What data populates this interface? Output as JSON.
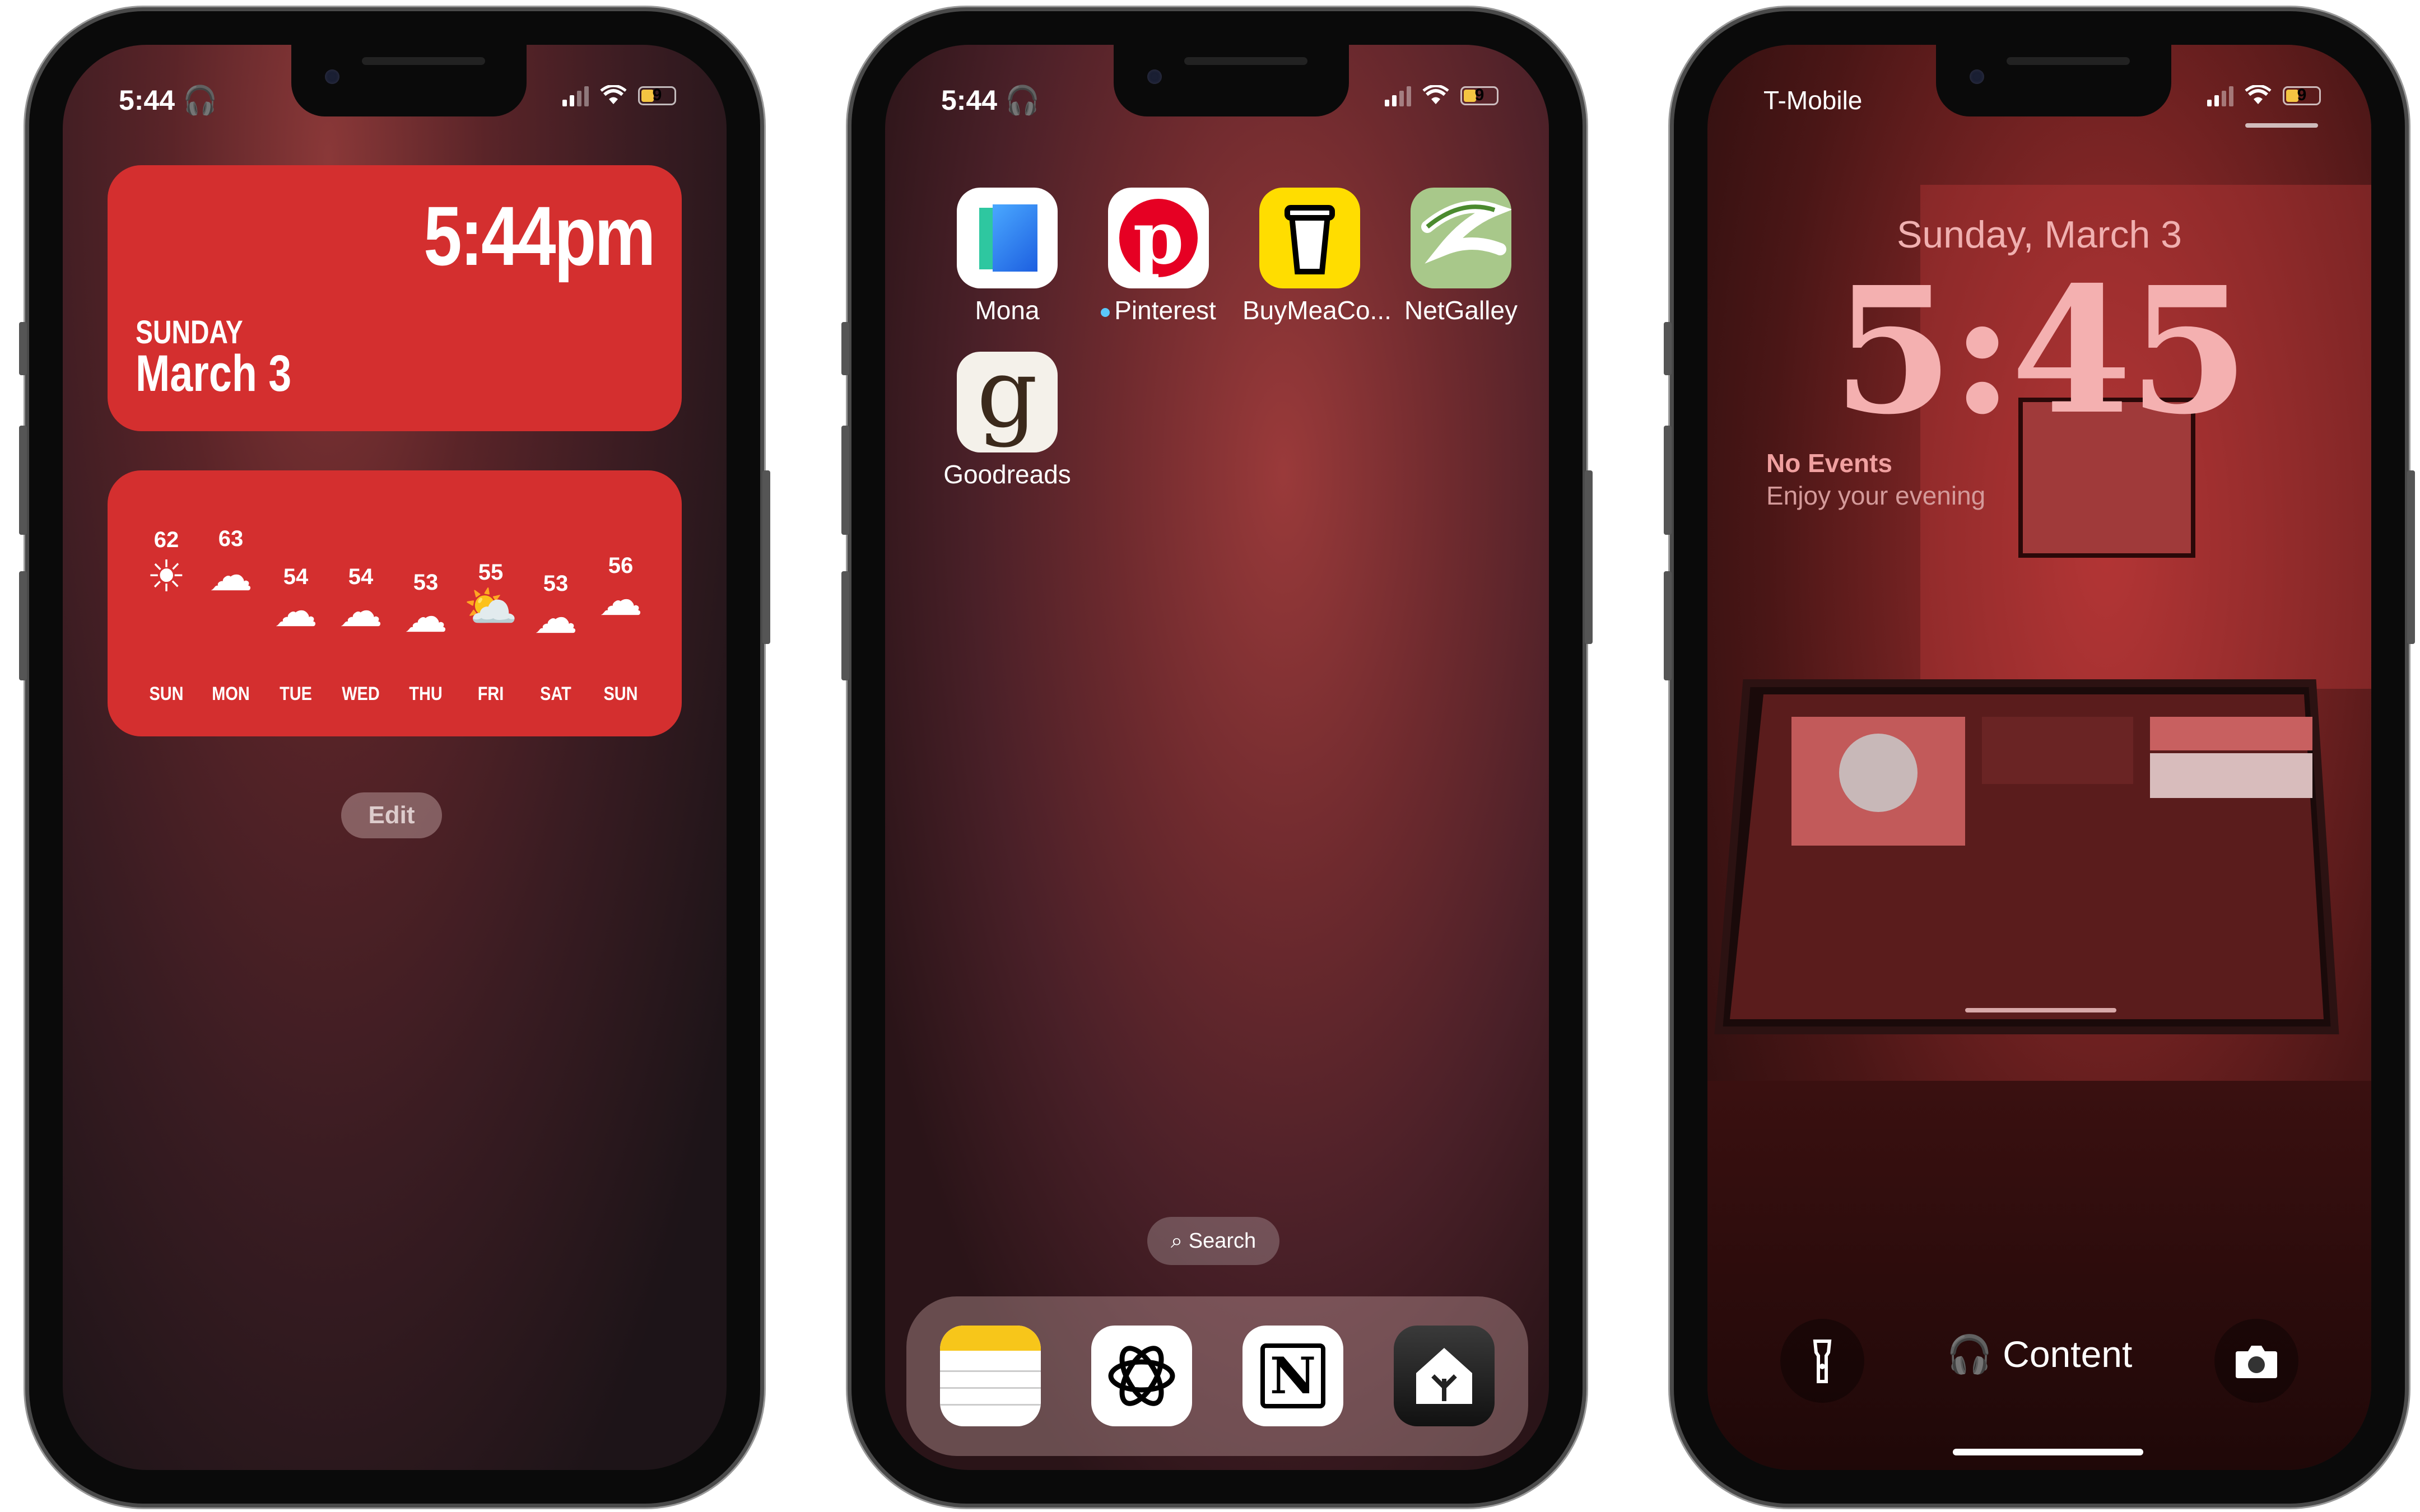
{
  "phone1": {
    "status": {
      "time": "5:44",
      "battery": "9"
    },
    "clock_widget": {
      "time": "5:44pm",
      "day": "SUNDAY",
      "date": "March 3"
    },
    "weather": [
      {
        "day": "SUN",
        "temp": "62",
        "icon": "sun-icon"
      },
      {
        "day": "MON",
        "temp": "63",
        "icon": "cloud-icon"
      },
      {
        "day": "TUE",
        "temp": "54",
        "icon": "rain-icon"
      },
      {
        "day": "WED",
        "temp": "54",
        "icon": "rain-icon"
      },
      {
        "day": "THU",
        "temp": "53",
        "icon": "rain-icon"
      },
      {
        "day": "FRI",
        "temp": "55",
        "icon": "partly-cloudy-icon"
      },
      {
        "day": "SAT",
        "temp": "53",
        "icon": "rain-icon"
      },
      {
        "day": "SUN",
        "temp": "56",
        "icon": "rain-icon"
      }
    ],
    "edit_label": "Edit"
  },
  "phone2": {
    "status": {
      "time": "5:44",
      "battery": "9"
    },
    "apps": [
      {
        "label": "Mona",
        "icon": "mona-app-icon"
      },
      {
        "label": "Pinterest",
        "icon": "pinterest-app-icon"
      },
      {
        "label": "BuyMeaCo...",
        "icon": "buymeacoffee-app-icon"
      },
      {
        "label": "NetGalley",
        "icon": "netgalley-app-icon"
      },
      {
        "label": "Goodreads",
        "icon": "goodreads-app-icon"
      }
    ],
    "search_label": "Search",
    "dock": [
      "notes-app-icon",
      "chatgpt-app-icon",
      "notion-app-icon",
      "home-app-icon"
    ]
  },
  "phone3": {
    "status": {
      "carrier": "T-Mobile",
      "battery": "9"
    },
    "date": "Sunday, March 3",
    "time": "5:45",
    "events_title": "No Events",
    "events_subtitle": "Enjoy your evening",
    "now_playing": "Content",
    "colors": {
      "accent": "#d42f2f",
      "lock_text": "#f4b0b0"
    }
  }
}
